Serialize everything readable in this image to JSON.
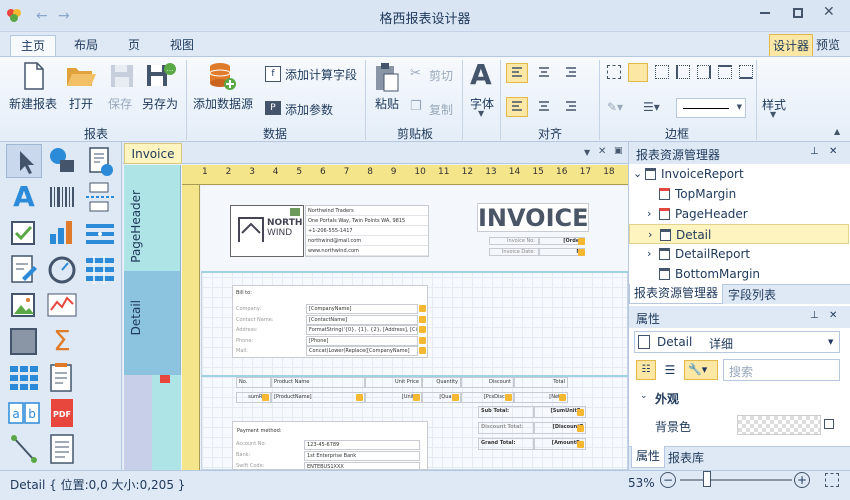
{
  "app": {
    "title": "格西报表设计器"
  },
  "ribbon": {
    "tabs": [
      "主页",
      "布局",
      "页",
      "视图"
    ],
    "right_buttons": [
      "设计器",
      "预览"
    ],
    "groups": {
      "report": {
        "label": "报表",
        "buttons": [
          "新建报表",
          "打开",
          "保存",
          "另存为"
        ]
      },
      "data": {
        "label": "数据",
        "buttons": [
          "添加数据源",
          "添加计算字段",
          "添加参数"
        ]
      },
      "clipboard": {
        "label": "剪贴板",
        "buttons": [
          "粘贴",
          "剪切",
          "复制"
        ]
      },
      "font": {
        "label": "字体"
      },
      "align": {
        "label": "对齐"
      },
      "border": {
        "label": "边框"
      },
      "style": {
        "label": "样式"
      }
    }
  },
  "document": {
    "tab": "Invoice",
    "bands": [
      "PageHeader",
      "Detail"
    ],
    "invoice": {
      "heading": "INVOICE",
      "logo_line1": "NORTH",
      "logo_line2": "WIND",
      "company": [
        "Northwind Traders",
        "One Portals Way,  Twin Points  WA,  9815",
        "+1-206-555-1417",
        "northwind@mail.com",
        "www.northwind.com"
      ],
      "invoice_no_label": "Invoice No:",
      "invoice_no_value": "[Order]",
      "invoice_date_label": "Invoice Date:",
      "invoice_date_value": "No",
      "bill_to": "Bill to:",
      "bill_rows": [
        {
          "label": "Company:",
          "value": "[CompanyName]"
        },
        {
          "label": "Contact Name:",
          "value": "[ContactName]"
        },
        {
          "label": "Address:",
          "value": "FormatString('{0}, {1}, {2}, [Address], [Ci"
        },
        {
          "label": "Phone:",
          "value": "[Phone]"
        },
        {
          "label": "Mail:",
          "value": "Concat(Lower(Replace([CompanyName]"
        }
      ],
      "table_headers": [
        "No.",
        "Product Name",
        "Unit Price",
        "Quantity",
        "Discount",
        "Total"
      ],
      "table_row": [
        "sumRec",
        "[ProductName]",
        "[UnitPr",
        "[Quanti",
        "[PcsDiscou",
        "[NetPr"
      ],
      "totals": [
        {
          "label": "Sub Total:",
          "value": "[SumUnitPr"
        },
        {
          "label": "Discount Total:",
          "value": "[DiscountT"
        },
        {
          "label": "Grand Total:",
          "value": "[AmountPa"
        }
      ],
      "payment_method": "Payment method:",
      "payment_rows": [
        {
          "label": "Account No:",
          "value": "123-45-6789"
        },
        {
          "label": "Bank:",
          "value": "1st Enterprise Bank"
        },
        {
          "label": "Swift Code:",
          "value": "ENTEBUS1XXX"
        }
      ]
    },
    "ruler_numbers": [
      "1",
      "2",
      "3",
      "4",
      "5",
      "6",
      "7",
      "8",
      "9",
      "10",
      "11",
      "12",
      "13",
      "14",
      "15",
      "16",
      "17",
      "18"
    ]
  },
  "explorer": {
    "title": "报表资源管理器",
    "items": [
      {
        "label": "InvoiceReport",
        "expand": "⌄"
      },
      {
        "label": "TopMargin",
        "expand": ""
      },
      {
        "label": "PageHeader",
        "expand": "›"
      },
      {
        "label": "Detail",
        "expand": "›"
      },
      {
        "label": "DetailReport",
        "expand": "›"
      },
      {
        "label": "BottomMargin",
        "expand": ""
      }
    ],
    "tabs": [
      "报表资源管理器",
      "字段列表"
    ]
  },
  "properties": {
    "title": "属性",
    "selected": "Detail",
    "selected_type": "详细",
    "search_placeholder": "搜索",
    "category": "外观",
    "prop_label": "背景色",
    "tabs": [
      "属性",
      "报表库"
    ]
  },
  "status": {
    "text": "Detail { 位置:0,0 大小:0,205 }",
    "zoom": "53%"
  },
  "colors": {
    "accent": "#2b579a",
    "band": "#aee4e6",
    "ruler": "#f4e48a",
    "selection": "#fdf4bf"
  }
}
